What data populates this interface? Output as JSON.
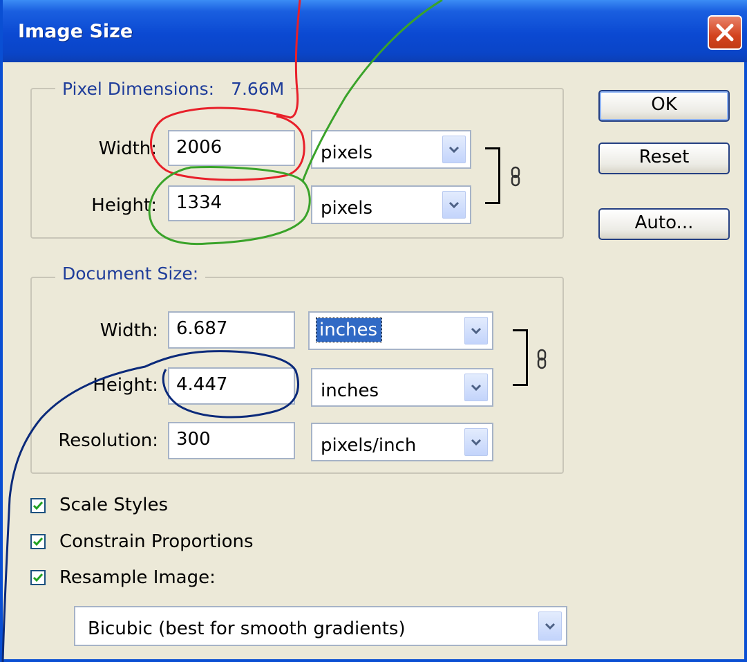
{
  "window": {
    "title": "Image Size",
    "close_label": "close"
  },
  "buttons": {
    "ok": "OK",
    "reset": "Reset",
    "auto": "Auto..."
  },
  "pixel_dimensions": {
    "legend": "Pixel Dimensions:",
    "size": "7.66M",
    "width_label": "Width:",
    "width_value": "2006",
    "width_unit": "pixels",
    "height_label": "Height:",
    "height_value": "1334",
    "height_unit": "pixels"
  },
  "document_size": {
    "legend": "Document Size:",
    "width_label": "Width:",
    "width_value": "6.687",
    "width_unit": "inches",
    "height_label": "Height:",
    "height_value": "4.447",
    "height_unit": "inches",
    "resolution_label": "Resolution:",
    "resolution_value": "300",
    "resolution_unit": "pixels/inch"
  },
  "options": {
    "scale_styles": {
      "label": "Scale Styles",
      "checked": true
    },
    "constrain_proportions": {
      "label": "Constrain Proportions",
      "checked": true
    },
    "resample_image": {
      "label": "Resample Image:",
      "checked": true
    },
    "resample_method": "Bicubic (best for smooth gradients)"
  },
  "icons": {
    "close": "close-x-icon",
    "dropdown": "chevron-down-icon",
    "link": "chain-link-icon",
    "checkmark": "checkmark-icon"
  },
  "colors": {
    "titlebar": "#0a45c8",
    "dialog_bg": "#ece9d8",
    "legend_text": "#1f3d9a",
    "selection": "#316ac5",
    "annotation_red": "#e8202a",
    "annotation_green": "#3aa32a",
    "annotation_navy": "#0b2a7a"
  }
}
